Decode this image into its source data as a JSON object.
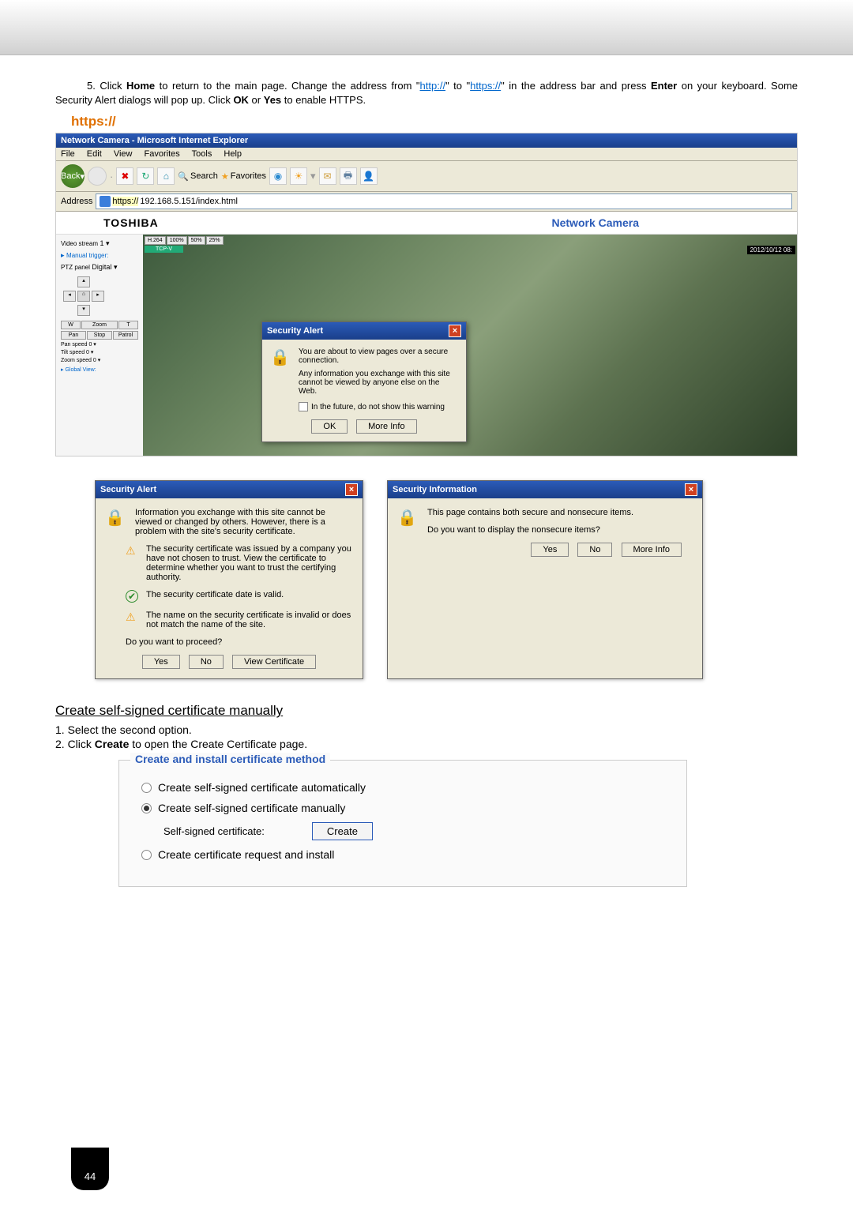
{
  "instruction": {
    "num": "5.",
    "text_parts": {
      "p1": " Click ",
      "home": "Home",
      "p2": " to return to the main page. Change the address from \"",
      "link1": "http://",
      "p3": "\" to \"",
      "link2": "https://",
      "p4": "\" in the address bar and press ",
      "enter": "Enter",
      "p5": " on your keyboard. Some Security Alert dialogs will pop up. Click ",
      "ok": "OK",
      "p6": " or ",
      "yes": "Yes",
      "p7": " to enable HTTPS."
    }
  },
  "https_label": "https://",
  "browser": {
    "title": "Network Camera - Microsoft Internet Explorer",
    "menu": [
      "File",
      "Edit",
      "View",
      "Favorites",
      "Tools",
      "Help"
    ],
    "back": "Back",
    "search": "Search",
    "favorites": "Favorites",
    "address_label": "Address",
    "url_prefix": "https://",
    "url_rest": "192.168.5.151/index.html"
  },
  "camera": {
    "brand": "TOSHIBA",
    "title": "Network Camera",
    "sidebar": {
      "video_stream": "Video stream",
      "video_stream_val": "1",
      "manual_trigger": "Manual trigger:",
      "ptz_panel": "PTZ panel",
      "ptz_val": "Digital",
      "w": "W",
      "zoom": "Zoom",
      "t": "T",
      "pan": "Pan",
      "stop": "Stop",
      "patrol": "Patrol",
      "pan_speed": "Pan speed",
      "pan_speed_val": "0",
      "tilt_speed": "Tilt speed",
      "tilt_speed_val": "0",
      "zoom_speed": "Zoom speed",
      "zoom_speed_val": "0",
      "global_view": "Global View:"
    },
    "tabs": [
      "H.264",
      "100%",
      "50%",
      "25%"
    ],
    "tcp": "TCP-V",
    "timestamp": "2012/10/12 08:"
  },
  "alert1": {
    "title": "Security Alert",
    "line1": "You are about to view pages over a secure connection.",
    "line2": "Any information you exchange with this site cannot be viewed by anyone else on the Web.",
    "checkbox": "In the future, do not show this warning",
    "ok": "OK",
    "more": "More Info"
  },
  "alert2": {
    "title": "Security Alert",
    "intro": "Information you exchange with this site cannot be viewed or changed by others. However, there is a problem with the site's security certificate.",
    "warn1": "The security certificate was issued by a company you have not chosen to trust. View the certificate to determine whether you want to trust the certifying authority.",
    "ok1": "The security certificate date is valid.",
    "warn2": "The name on the security certificate is invalid or does not match the name of the site.",
    "proceed": "Do you want to proceed?",
    "yes": "Yes",
    "no": "No",
    "view": "View Certificate"
  },
  "alert3": {
    "title": "Security Information",
    "line1": "This page contains both secure and nonsecure items.",
    "line2": "Do you want to display the nonsecure items?",
    "yes": "Yes",
    "no": "No",
    "more": "More Info"
  },
  "section2": {
    "heading": "Create self-signed certificate manually",
    "step1": "1. Select the second option.",
    "step2_a": "2. Click ",
    "step2_b": "Create",
    "step2_c": " to open the Create Certificate page."
  },
  "cert_method": {
    "legend": "Create and install certificate method",
    "opt1": "Create self-signed certificate automatically",
    "opt2": "Create self-signed certificate manually",
    "sub_label": "Self-signed certificate:",
    "create": "Create",
    "opt3": "Create certificate request and install"
  },
  "page_number": "44"
}
